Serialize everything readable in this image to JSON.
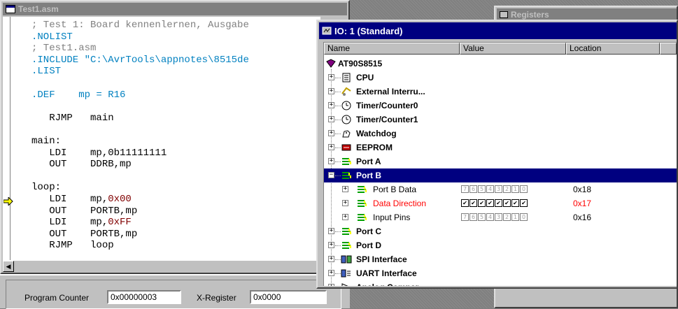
{
  "source_window": {
    "title": "Test1.asm",
    "buttons": [
      "_",
      "□",
      "×"
    ],
    "code_lines": [
      {
        "text": "; Test 1: Board kennenlernen, Ausgabe",
        "color": "#808080"
      },
      {
        "text": ".NOLIST",
        "color": "#0080c0"
      },
      {
        "text": "; Test1.asm",
        "color": "#808080"
      },
      {
        "text": ".INCLUDE \"C:\\AvrTools\\appnotes\\8515de",
        "color": "#0080c0"
      },
      {
        "text": ".LIST",
        "color": "#0080c0"
      },
      {
        "text": "",
        "color": "#000000"
      },
      {
        "text": ".DEF    mp = R16",
        "color": "#0080c0"
      },
      {
        "text": "",
        "color": "#000000"
      },
      {
        "text": "   RJMP   main",
        "color": "#000000"
      },
      {
        "text": "",
        "color": "#000000"
      },
      {
        "text": "main:",
        "color": "#000000"
      },
      {
        "text": "   LDI    mp,0b11111111",
        "color": "#000000"
      },
      {
        "text": "   OUT    DDRB,mp",
        "color": "#000000"
      },
      {
        "text": "",
        "color": "#000000"
      },
      {
        "text": "loop:",
        "color": "#000000"
      },
      {
        "text": "   LDI    mp,",
        "color": "#000000",
        "extra": "0x00",
        "extra_color": "#800000"
      },
      {
        "text": "   OUT    PORTB,mp",
        "color": "#000000"
      },
      {
        "text": "   LDI    mp,",
        "color": "#000000",
        "extra": "0xFF",
        "extra_color": "#800000"
      },
      {
        "text": "   OUT    PORTB,mp",
        "color": "#000000"
      },
      {
        "text": "   RJMP   loop",
        "color": "#000000"
      }
    ]
  },
  "status": {
    "pc_label": "Program Counter",
    "pc_value": "0x00000003",
    "x_label": "X-Register",
    "x_value": "0x0000"
  },
  "registers_window": {
    "title": "Registers"
  },
  "io_window": {
    "title": "IO: 1 (Standard)",
    "columns": [
      "Name",
      "Value",
      "Location"
    ],
    "root": "AT90S8515",
    "items": [
      {
        "label": "CPU",
        "icon": "cpu-icon"
      },
      {
        "label": "External Interru...",
        "icon": "interrupt-icon"
      },
      {
        "label": "Timer/Counter0",
        "icon": "timer-icon"
      },
      {
        "label": "Timer/Counter1",
        "icon": "timer-icon"
      },
      {
        "label": "Watchdog",
        "icon": "watchdog-icon"
      },
      {
        "label": "EEPROM",
        "icon": "eeprom-icon"
      },
      {
        "label": "Port A",
        "icon": "port-icon"
      },
      {
        "label": "Port B",
        "icon": "port-icon",
        "selected": true
      },
      {
        "label": "Port C",
        "icon": "port-icon"
      },
      {
        "label": "Port D",
        "icon": "port-icon"
      },
      {
        "label": "SPI Interface",
        "icon": "spi-icon"
      },
      {
        "label": "UART Interface",
        "icon": "uart-icon"
      },
      {
        "label": "Analog Compar...",
        "icon": "analog-icon"
      }
    ],
    "port_b_children": [
      {
        "label": "Port B Data",
        "bits": [
          false,
          false,
          false,
          false,
          false,
          false,
          false,
          false
        ],
        "location": "0x18",
        "highlight": false
      },
      {
        "label": "Data Direction",
        "bits": [
          true,
          true,
          true,
          true,
          true,
          true,
          true,
          true
        ],
        "location": "0x17",
        "highlight": true
      },
      {
        "label": "Input Pins",
        "bits": [
          false,
          false,
          false,
          false,
          false,
          false,
          false,
          false
        ],
        "location": "0x16",
        "highlight": false
      }
    ],
    "bit_labels": [
      "7",
      "6",
      "5",
      "4",
      "3",
      "2",
      "1",
      "0"
    ]
  }
}
